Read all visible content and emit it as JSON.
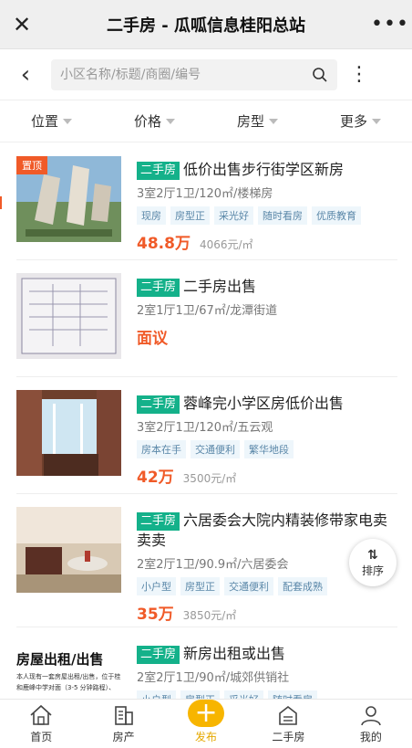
{
  "titlebar": {
    "close_glyph": "✕",
    "title": "二手房 - 瓜呱信息桂阳总站",
    "more_glyph": "•••"
  },
  "search": {
    "back_glyph": "‹",
    "placeholder": "小区名称/标题/商圈/编号",
    "menu_glyph": "⋮"
  },
  "filters": [
    {
      "label": "位置"
    },
    {
      "label": "价格"
    },
    {
      "label": "房型"
    },
    {
      "label": "更多"
    }
  ],
  "listings": [
    {
      "pin": "置顶",
      "tag": "二手房",
      "title": "低价出售步行街学区新房",
      "meta": "3室2厅1卫/120㎡/楼梯房",
      "features": [
        "现房",
        "房型正",
        "采光好",
        "随时看房",
        "优质教育"
      ],
      "price": "48.8万",
      "unit_price": "4066元/㎡"
    },
    {
      "tag": "二手房",
      "title": "二手房出售",
      "meta": "2室1厅1卫/67㎡/龙潭街道",
      "features": [],
      "price": "面议",
      "unit_price": ""
    },
    {
      "tag": "二手房",
      "title": "蓉峰完小学区房低价出售",
      "meta": "3室2厅1卫/120㎡/五云观",
      "features": [
        "房本在手",
        "交通便利",
        "繁华地段"
      ],
      "price": "42万",
      "unit_price": "3500元/㎡"
    },
    {
      "tag": "二手房",
      "title": "六居委会大院内精装修带家电卖卖卖",
      "meta": "2室2厅1卫/90.9㎡/六居委会",
      "features": [
        "小户型",
        "房型正",
        "交通便利",
        "配套成熟"
      ],
      "price": "35万",
      "unit_price": "3850元/㎡"
    },
    {
      "tag": "二手房",
      "title": "新房出租或出售",
      "meta": "2室2厅1卫/90㎡/城郊供销社",
      "features": [
        "小户型",
        "房型正",
        "采光好",
        "随时看房"
      ],
      "price": "",
      "unit_price": ""
    }
  ],
  "thumb5": {
    "heading": "房屋出租/出售",
    "line1": "本人现有一套房屋出租/出售，位于桂",
    "line2": "和鹿峰中学对面（3-5 分钟路程）、"
  },
  "sort": {
    "label": "排序",
    "glyph": "⇅"
  },
  "tabbar": [
    {
      "label": "首页",
      "icon": "home-icon"
    },
    {
      "label": "房产",
      "icon": "building-icon"
    },
    {
      "label": "发布",
      "icon": "plus-icon"
    },
    {
      "label": "二手房",
      "icon": "house-icon"
    },
    {
      "label": "我的",
      "icon": "user-icon"
    }
  ],
  "colors": {
    "accent": "#f05a28",
    "tag_green": "#14b18a",
    "publish_yellow": "#f7b500"
  }
}
